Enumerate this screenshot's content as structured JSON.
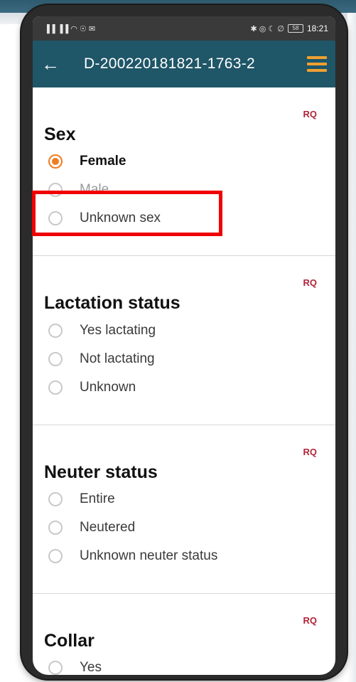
{
  "statusbar": {
    "left_icons": "▐▐ ▐▐ ◠ ☉ ✉",
    "right_icons": "✱ ◎ ☾ ∅",
    "battery": "58",
    "time": "18:21"
  },
  "appbar": {
    "title": "D-200220181821-1763-2",
    "back_icon": "arrow-left-icon",
    "menu_icon": "hamburger-menu-icon"
  },
  "required_label": "RQ",
  "sections": [
    {
      "title": "Sex",
      "options": [
        {
          "label": "Female",
          "checked": true
        },
        {
          "label": "Male",
          "checked": false
        },
        {
          "label": "Unknown sex",
          "checked": false
        }
      ]
    },
    {
      "title": "Lactation status",
      "options": [
        {
          "label": "Yes lactating",
          "checked": false
        },
        {
          "label": "Not lactating",
          "checked": false
        },
        {
          "label": "Unknown",
          "checked": false
        }
      ]
    },
    {
      "title": "Neuter status",
      "options": [
        {
          "label": "Entire",
          "checked": false
        },
        {
          "label": "Neutered",
          "checked": false
        },
        {
          "label": "Unknown neuter status",
          "checked": false
        }
      ]
    },
    {
      "title": "Collar",
      "options": [
        {
          "label": "Yes",
          "checked": false
        }
      ]
    }
  ],
  "colors": {
    "appbar": "#1f5668",
    "accent": "#ef7d22",
    "required": "#b0243a",
    "highlight": "#f00000"
  }
}
